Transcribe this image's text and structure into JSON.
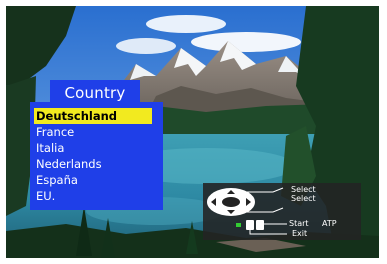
{
  "menu": {
    "title": "Country",
    "selected_index": 0,
    "items": [
      {
        "label": "Deutschland"
      },
      {
        "label": "France"
      },
      {
        "label": "Italia"
      },
      {
        "label": "Nederlands"
      },
      {
        "label": "España"
      },
      {
        "label": "EU."
      }
    ]
  },
  "help": {
    "select_up": "Select",
    "select_down": "Select",
    "start": "Start",
    "atp": "ATP",
    "exit": "Exit"
  },
  "colors": {
    "menu_bg": "#1f3fe8",
    "highlight": "#f2ea1f",
    "help_bg": "#232323",
    "start_button": "#33cc33"
  }
}
